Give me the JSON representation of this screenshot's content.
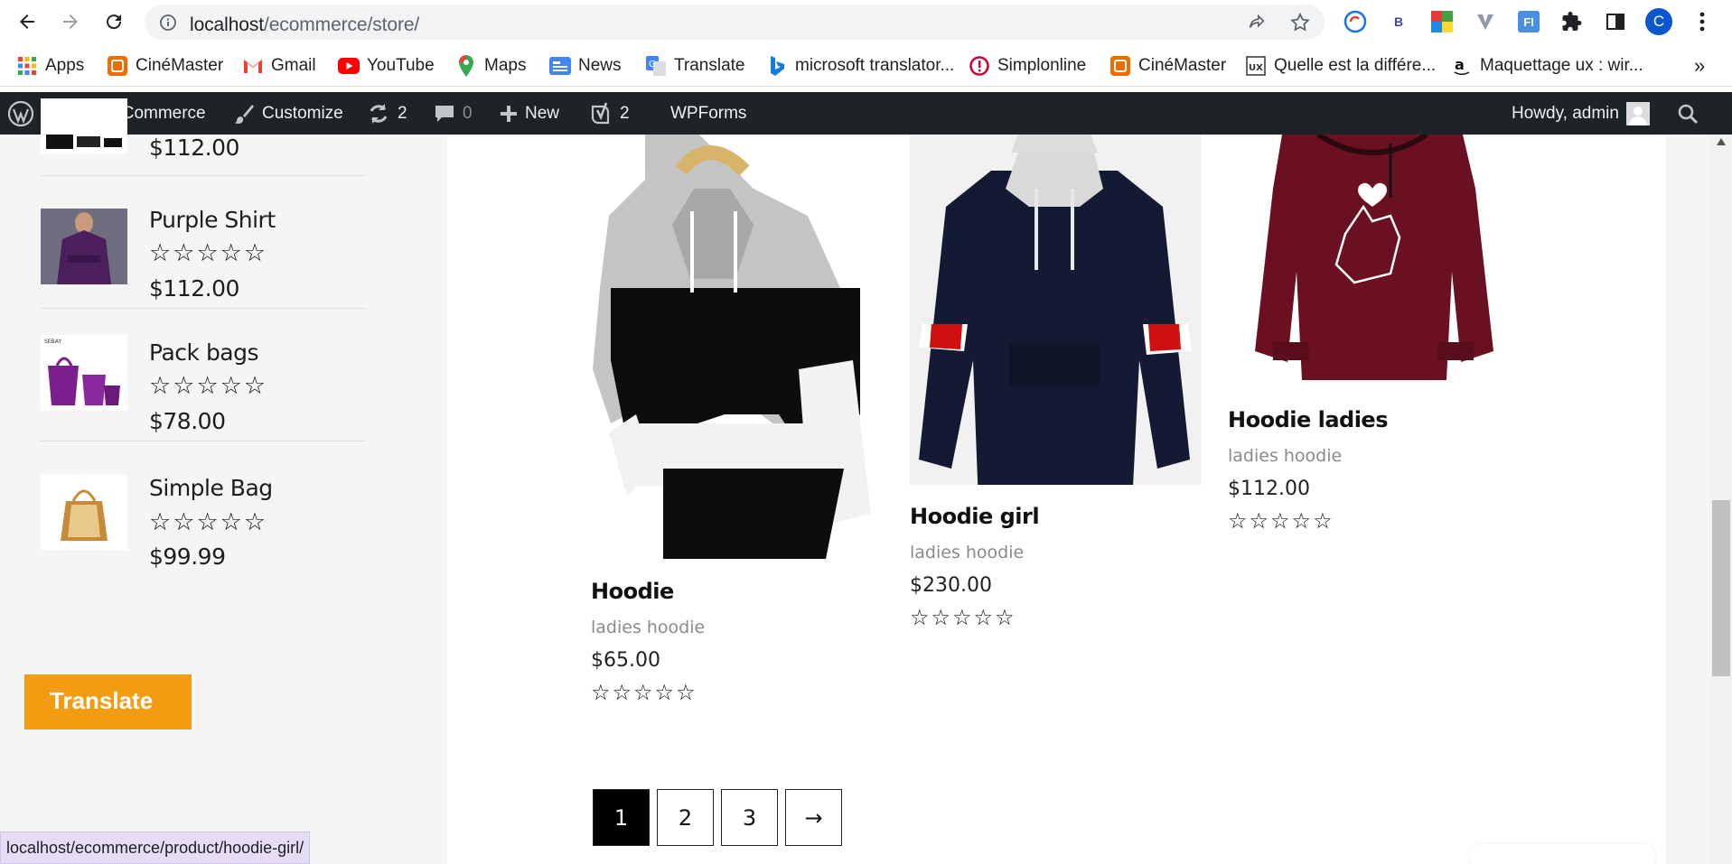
{
  "browser": {
    "url_host": "localhost",
    "url_path": "/ecommerce/store/",
    "profile_initial": "C",
    "ext_b_label": "B",
    "ext_fi_label": "FI"
  },
  "bookmarks": [
    {
      "label": "Apps",
      "icon": "apps-grid-icon"
    },
    {
      "label": "CinéMaster",
      "icon": "cinemaster-icon"
    },
    {
      "label": "Gmail",
      "icon": "gmail-icon"
    },
    {
      "label": "YouTube",
      "icon": "youtube-icon"
    },
    {
      "label": "Maps",
      "icon": "maps-icon"
    },
    {
      "label": "News",
      "icon": "news-icon"
    },
    {
      "label": "Translate",
      "icon": "translate-icon"
    },
    {
      "label": "microsoft translator...",
      "icon": "bing-icon"
    },
    {
      "label": "Simplonline",
      "icon": "simplonline-icon"
    },
    {
      "label": "CinéMaster",
      "icon": "cinemaster-icon"
    },
    {
      "label": "Quelle est la différe...",
      "icon": "blog-ux-icon"
    },
    {
      "label": "Maquettage ux : wir...",
      "icon": "amazon-icon"
    }
  ],
  "bookmarks_overflow": "»",
  "adminbar": {
    "woocommerce": "WooCommerce",
    "customize": "Customize",
    "updates_count": "2",
    "comments_count": "0",
    "new": "New",
    "yoast_count": "2",
    "wpforms": "WPForms",
    "howdy": "Howdy, admin"
  },
  "sidebar": {
    "top_price": "$112.00",
    "items": [
      {
        "name": "Purple Shirt",
        "price": "$112.00",
        "rating": 0
      },
      {
        "name": "Pack bags",
        "price": "$78.00",
        "rating": 0
      },
      {
        "name": "Simple Bag",
        "price": "$99.99",
        "rating": 0
      }
    ],
    "pack_bags_thumb_text": "SEBAY"
  },
  "products": [
    {
      "title": "Hoodie",
      "category": "ladies hoodie",
      "price": "$65.00",
      "rating": 0
    },
    {
      "title": "Hoodie girl",
      "category": "ladies hoodie",
      "price": "$230.00",
      "rating": 0
    },
    {
      "title": "Hoodie ladies",
      "category": "ladies hoodie",
      "price": "$112.00",
      "rating": 0
    }
  ],
  "pagination": {
    "pages": [
      "1",
      "2",
      "3"
    ],
    "current": "1",
    "next": "→"
  },
  "translate_tab": "Translate",
  "status_url": "localhost/ecommerce/product/hoodie-girl/",
  "colors": {
    "adminbar_bg": "#1d2327",
    "translate_orange": "#f39c12",
    "pager_active": "#000000"
  }
}
